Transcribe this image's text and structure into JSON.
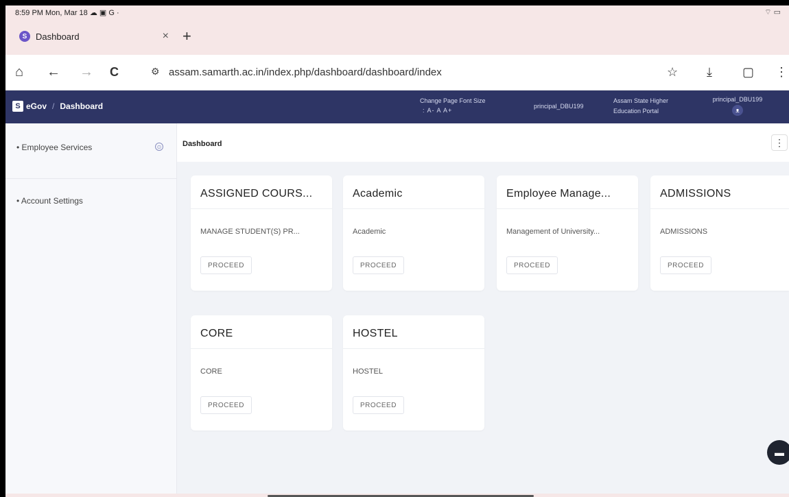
{
  "statusbar": {
    "time": "8:59 PM Mon, Mar 18 ☁ ▣ G ·",
    "right": "⌔ ▭"
  },
  "tab": {
    "favicon": "S",
    "title": "Dashboard",
    "close": "×",
    "new": "+"
  },
  "addressbar": {
    "url": "assam.samarth.ac.in/index.php/dashboard/dashboard/index",
    "home": "⌂",
    "back": "←",
    "forward": "→",
    "reload": "C",
    "tune": "⚙",
    "star": "☆",
    "download": "⤓",
    "tabs": "▢",
    "menu": "⋮"
  },
  "header": {
    "logo": "S",
    "brand": "eGov",
    "separator": "/",
    "page": "Dashboard",
    "font_label": "Change Page Font Size",
    "font_sizes": ": A- A A+",
    "user1": "principal_DBU199",
    "portal": "Assam State Higher Education Portal",
    "user2": "principal_DBU199",
    "avatar": "ᴥ"
  },
  "sidebar": {
    "items": [
      {
        "label": "• Employee Services"
      },
      {
        "label": "• Account Settings"
      }
    ],
    "toggle": "⊙"
  },
  "main": {
    "breadcrumb": "Dashboard",
    "kebab": "⋮",
    "cards": [
      {
        "title": "ASSIGNED COURS...",
        "desc": "MANAGE STUDENT(S) PR...",
        "button": "PROCEED"
      },
      {
        "title": "Academic",
        "desc": "Academic",
        "button": "PROCEED"
      },
      {
        "title": "Employee Manage...",
        "desc": "Management of University...",
        "button": "PROCEED"
      },
      {
        "title": "ADMISSIONS",
        "desc": "ADMISSIONS",
        "button": "PROCEED"
      },
      {
        "title": "CORE",
        "desc": "CORE",
        "button": "PROCEED"
      },
      {
        "title": "HOSTEL",
        "desc": "HOSTEL",
        "button": "PROCEED"
      }
    ]
  },
  "chat": {
    "icon": "▬"
  },
  "colors": {
    "header_bg": "#2e3565",
    "page_bg": "#f1f3f7",
    "chrome_bg": "#f6e7e7"
  }
}
